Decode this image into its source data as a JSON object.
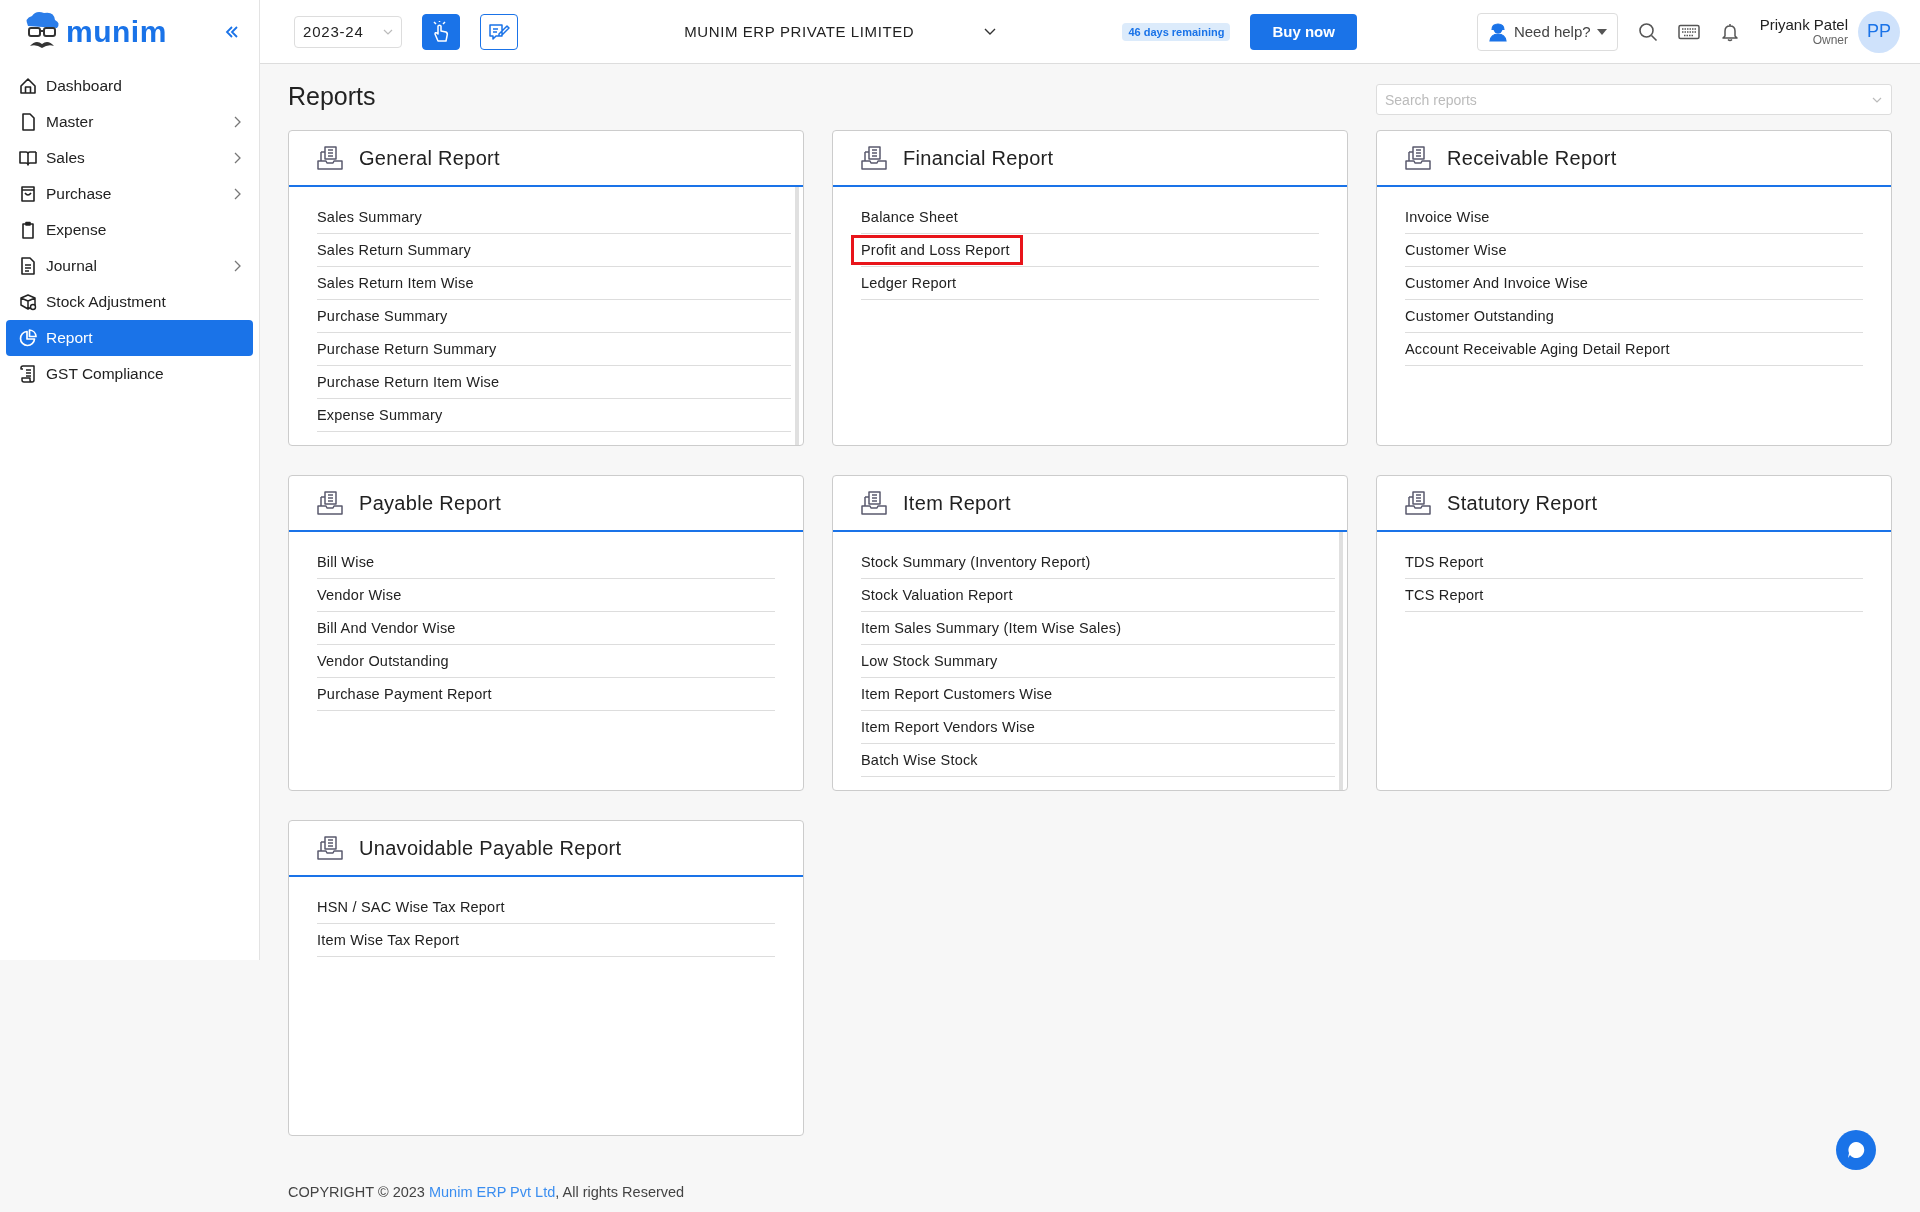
{
  "logo": {
    "text": "munim"
  },
  "topbar": {
    "financial_year": "2023-24",
    "company": "MUNIM ERP PRIVATE LIMITED",
    "trial_badge": "46 days remaining",
    "buy_button": "Buy now",
    "help_button": "Need help?",
    "user": {
      "name": "Priyank Patel",
      "role": "Owner",
      "initials": "PP"
    }
  },
  "sidebar": {
    "items": [
      {
        "label": "Dashboard",
        "has_submenu": false,
        "selected": false
      },
      {
        "label": "Master",
        "has_submenu": true,
        "selected": false
      },
      {
        "label": "Sales",
        "has_submenu": true,
        "selected": false
      },
      {
        "label": "Purchase",
        "has_submenu": true,
        "selected": false
      },
      {
        "label": "Expense",
        "has_submenu": false,
        "selected": false
      },
      {
        "label": "Journal",
        "has_submenu": true,
        "selected": false
      },
      {
        "label": "Stock Adjustment",
        "has_submenu": false,
        "selected": false
      },
      {
        "label": "Report",
        "has_submenu": false,
        "selected": true
      },
      {
        "label": "GST Compliance",
        "has_submenu": false,
        "selected": false
      }
    ]
  },
  "page": {
    "title": "Reports",
    "search": {
      "placeholder": "Search reports"
    }
  },
  "cards": [
    {
      "title": "General Report",
      "scrollable": true,
      "items": [
        {
          "label": "Sales Summary",
          "highlighted": false
        },
        {
          "label": "Sales Return Summary",
          "highlighted": false
        },
        {
          "label": "Sales Return Item Wise",
          "highlighted": false
        },
        {
          "label": "Purchase Summary",
          "highlighted": false
        },
        {
          "label": "Purchase Return Summary",
          "highlighted": false
        },
        {
          "label": "Purchase Return Item Wise",
          "highlighted": false
        },
        {
          "label": "Expense Summary",
          "highlighted": false
        }
      ]
    },
    {
      "title": "Financial Report",
      "scrollable": false,
      "items": [
        {
          "label": "Balance Sheet",
          "highlighted": false
        },
        {
          "label": "Profit and Loss Report",
          "highlighted": true
        },
        {
          "label": "Ledger Report",
          "highlighted": false
        }
      ]
    },
    {
      "title": "Receivable Report",
      "scrollable": false,
      "items": [
        {
          "label": "Invoice Wise",
          "highlighted": false
        },
        {
          "label": "Customer Wise",
          "highlighted": false
        },
        {
          "label": "Customer And Invoice Wise",
          "highlighted": false
        },
        {
          "label": "Customer Outstanding",
          "highlighted": false
        },
        {
          "label": "Account Receivable Aging Detail Report",
          "highlighted": false
        }
      ]
    },
    {
      "title": "Payable Report",
      "scrollable": false,
      "items": [
        {
          "label": "Bill Wise",
          "highlighted": false
        },
        {
          "label": "Vendor Wise",
          "highlighted": false
        },
        {
          "label": "Bill And Vendor Wise",
          "highlighted": false
        },
        {
          "label": "Vendor Outstanding",
          "highlighted": false
        },
        {
          "label": "Purchase Payment Report",
          "highlighted": false
        }
      ]
    },
    {
      "title": "Item Report",
      "scrollable": true,
      "items": [
        {
          "label": "Stock Summary (Inventory Report)",
          "highlighted": false
        },
        {
          "label": "Stock Valuation Report",
          "highlighted": false
        },
        {
          "label": "Item Sales Summary (Item Wise Sales)",
          "highlighted": false
        },
        {
          "label": "Low Stock Summary",
          "highlighted": false
        },
        {
          "label": "Item Report Customers Wise",
          "highlighted": false
        },
        {
          "label": "Item Report Vendors Wise",
          "highlighted": false
        },
        {
          "label": "Batch Wise Stock",
          "highlighted": false
        }
      ]
    },
    {
      "title": "Statutory Report",
      "scrollable": false,
      "items": [
        {
          "label": "TDS Report",
          "highlighted": false
        },
        {
          "label": "TCS Report",
          "highlighted": false
        }
      ]
    },
    {
      "title": "Unavoidable Payable Report",
      "scrollable": false,
      "items": [
        {
          "label": "HSN / SAC Wise Tax Report",
          "highlighted": false
        },
        {
          "label": "Item Wise Tax Report",
          "highlighted": false
        }
      ]
    }
  ],
  "footer": {
    "prefix": "COPYRIGHT © 2023 ",
    "link": "Munim ERP Pvt Ltd",
    "suffix": ", All rights Reserved"
  }
}
